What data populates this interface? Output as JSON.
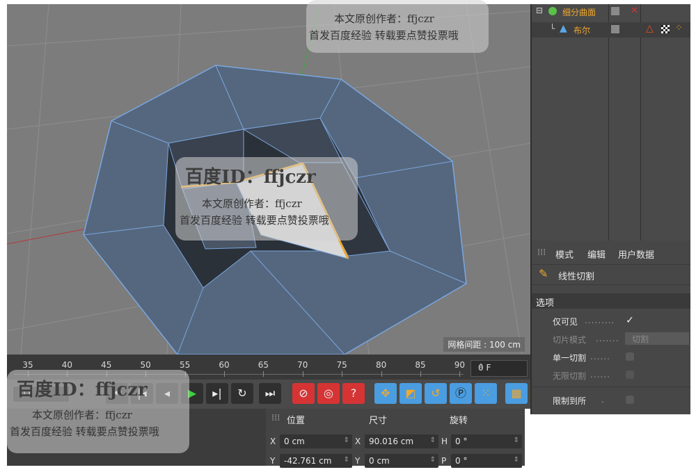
{
  "viewport": {
    "grid_readout": "网格间距 : 100 cm"
  },
  "object_manager": {
    "items": [
      {
        "label": "细分曲面",
        "color": "#f0a830"
      },
      {
        "label": "布尔",
        "color": "#f0a830"
      }
    ]
  },
  "attributes": {
    "tabs": [
      "模式",
      "编辑",
      "用户数据"
    ],
    "tool_title": "线性切割",
    "section": "选项",
    "options": [
      {
        "label": "仅可见",
        "dots": ".........",
        "checked": true
      },
      {
        "label": "切片模式",
        "dots": ".......",
        "dropdown": "切割"
      },
      {
        "label": "单一切割",
        "dots": "......",
        "checked": false
      },
      {
        "label": "无限切割",
        "dots": "......",
        "checked": false
      },
      {
        "label": "限制到所",
        "dots": ".",
        "checked": false
      }
    ]
  },
  "timeline": {
    "ticks": [
      "35",
      "40",
      "45",
      "50",
      "55",
      "60",
      "65",
      "70",
      "75",
      "80",
      "85",
      "90"
    ],
    "frame": "0 F",
    "current_frame_left": "0 F"
  },
  "toolbar": {
    "icons": [
      "skip-start-icon",
      "prev-key-icon",
      "play-back-icon",
      "play-icon",
      "next-key-icon",
      "loop-icon",
      "skip-end-icon",
      "record-icon",
      "autokey-icon",
      "help-icon",
      "move-icon",
      "scale-icon",
      "rotate-icon",
      "p-icon",
      "dots-icon",
      "film-icon"
    ]
  },
  "coordinates": {
    "headers": [
      "位置",
      "尺寸",
      "旋转"
    ],
    "rows": [
      {
        "axis_pos": "X",
        "pos": "0 cm",
        "axis_size": "X",
        "size": "90.016 cm",
        "axis_rot": "H",
        "rot": "0 °"
      },
      {
        "axis_pos": "Y",
        "pos": "-42.761 cm",
        "axis_size": "Y",
        "size": "0 cm",
        "axis_rot": "P",
        "rot": "0 °"
      }
    ]
  },
  "watermarks": {
    "id_text": "百度ID：ffjczr",
    "line1": "本文原创作者：ffjczr",
    "line2": "首发百度经验  转载要点赞投票哦"
  },
  "colors": {
    "accent": "#f0a830",
    "active_blue": "#4a9de0",
    "record_red": "#d63434",
    "mesh_edge": "#7aa7e0"
  }
}
